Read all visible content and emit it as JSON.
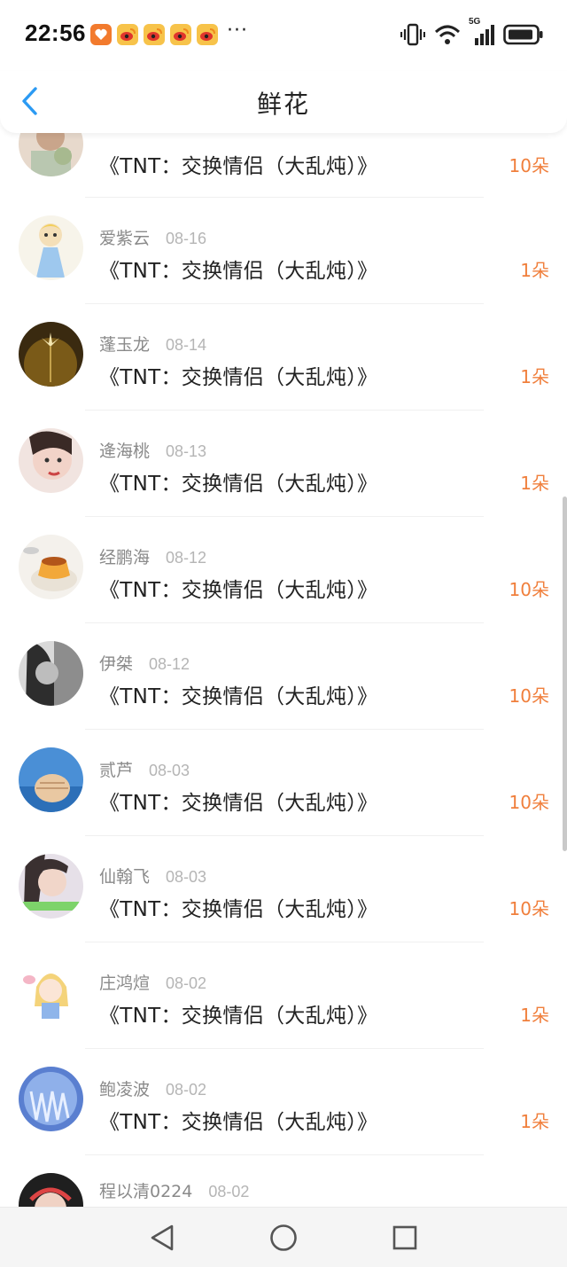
{
  "status_bar": {
    "time": "22:56",
    "more": "···",
    "network": "5G",
    "notification_icons": [
      "app-icon",
      "weibo-icon",
      "weibo-icon",
      "weibo-icon",
      "weibo-icon"
    ]
  },
  "header": {
    "title": "鲜花",
    "back_icon": "chevron-left-icon"
  },
  "colors": {
    "accent": "#2b9af3",
    "count": "#f07f3c",
    "name": "#8a8a8a",
    "date": "#b5b5b5"
  },
  "list": {
    "rows": [
      {
        "name": "",
        "date": "",
        "book": "《TNT：交换情侣（大乱炖）》",
        "count": "10朵"
      },
      {
        "name": "爱紫云",
        "date": "08-16",
        "book": "《TNT：交换情侣（大乱炖）》",
        "count": "1朵"
      },
      {
        "name": "蓬玉龙",
        "date": "08-14",
        "book": "《TNT：交换情侣（大乱炖）》",
        "count": "1朵"
      },
      {
        "name": "逄海桃",
        "date": "08-13",
        "book": "《TNT：交换情侣（大乱炖）》",
        "count": "1朵"
      },
      {
        "name": "经鹏海",
        "date": "08-12",
        "book": "《TNT：交换情侣（大乱炖）》",
        "count": "10朵"
      },
      {
        "name": "伊桀",
        "date": "08-12",
        "book": "《TNT：交换情侣（大乱炖）》",
        "count": "10朵"
      },
      {
        "name": "贰芦",
        "date": "08-03",
        "book": "《TNT：交换情侣（大乱炖）》",
        "count": "10朵"
      },
      {
        "name": "仙翰飞",
        "date": "08-03",
        "book": "《TNT：交换情侣（大乱炖）》",
        "count": "10朵"
      },
      {
        "name": "庄鸿煊",
        "date": "08-02",
        "book": "《TNT：交换情侣（大乱炖）》",
        "count": "1朵"
      },
      {
        "name": "鲍凌波",
        "date": "08-02",
        "book": "《TNT：交换情侣（大乱炖）》",
        "count": "1朵"
      },
      {
        "name": "程以清0224",
        "date": "08-02",
        "book": "",
        "count": ""
      }
    ]
  },
  "nav_bar": {
    "back_icon": "triangle-back-icon",
    "home_icon": "circle-home-icon",
    "recent_icon": "square-recent-icon"
  }
}
